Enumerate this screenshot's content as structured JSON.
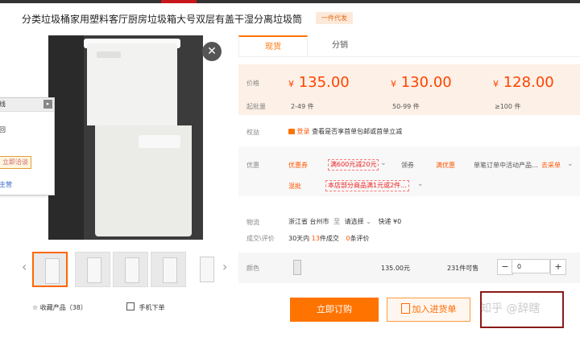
{
  "title": "分类垃圾桶家用塑料客厅厨房垃圾箱大号双层有盖干湿分离垃圾筒",
  "dropship_badge": "一件代发",
  "close_glyph": "✕",
  "chat_popup": {
    "header": "线",
    "line1": "回",
    "button": "立即洽谈",
    "line2": "主营",
    "arrow_glyph": "▸"
  },
  "tabs": [
    "现货",
    "分销"
  ],
  "price_section": {
    "price_label": "价格",
    "qty_label": "起批量",
    "currency": "¥",
    "tiers": [
      {
        "price": "135.00",
        "qty": "2-49 件"
      },
      {
        "price": "130.00",
        "qty": "50-99 件"
      },
      {
        "price": "128.00",
        "qty": "≥100 件"
      }
    ]
  },
  "benefit": {
    "label": "权益",
    "login": "登录",
    "text": "查看是否享首单包邮或首单立减"
  },
  "discount": {
    "label": "优惠",
    "coupon_label": "优惠券",
    "coupon_value": "满600元减20元",
    "coupon_more": "⌄",
    "tag": "领券",
    "reduce_label": "满优惠",
    "reduce_desc": "单笔订单中活动产品…",
    "reduce_link": "去采单",
    "promo_label": "混批",
    "promo_value": "本店部分商品满1元或2件…",
    "promo_more": "⌄"
  },
  "logistics": {
    "label": "物流",
    "origin": "浙江省 台州市",
    "to": "至",
    "dest": "请选择",
    "dest_arrow": "⌄",
    "express": "快递 ¥0"
  },
  "deals": {
    "label": "成交\\评价",
    "period": "30天内",
    "count": "13",
    "count_suffix": "件成交",
    "reviews": "0",
    "reviews_suffix": "条评价"
  },
  "color_row": {
    "label": "颜色",
    "price": "135.00元",
    "stock": "231件可售",
    "quantity": "0",
    "minus": "−",
    "plus": "+"
  },
  "thumb_nav": {
    "prev": "‹",
    "next": "›"
  },
  "favorite": {
    "star": "☆",
    "label": "收藏产品（38）"
  },
  "phone_order": {
    "label": "手机下单"
  },
  "buttons": {
    "order": "立即订购",
    "cart": "加入进货单"
  },
  "watermark": "知乎 @辞瞎",
  "colors": {
    "accent": "#ff7300",
    "price": "#ff4400",
    "highlight": "#8b1a1a"
  }
}
